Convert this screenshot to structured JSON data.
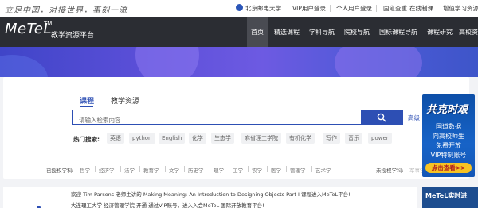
{
  "topbar": {
    "slogan": "立足中国，对接世界，事刻一流",
    "university": "北京邮电大学",
    "links": [
      "VIP用户登录",
      "个人用户登录",
      "国道查重",
      "在线制课",
      "增值学习资源"
    ]
  },
  "navbar": {
    "logo": "MeTeL",
    "logo_tm": "TM",
    "logo_subtitle": "教学资源平台",
    "items": [
      "首页",
      "精选课程",
      "学科导航",
      "院校导航",
      "国标课程导航",
      "课程研究",
      "高校资"
    ]
  },
  "search": {
    "tabs": [
      "课程",
      "教学资源"
    ],
    "placeholder": "请输入检索内容",
    "advanced_label": "高级",
    "hot_label": "热门搜索:",
    "hot_tags": [
      "英语",
      "python",
      "English",
      "化学",
      "生态学",
      "麻省理工学院",
      "有机化学",
      "写作",
      "音乐",
      "power"
    ]
  },
  "subjects": {
    "enabled_label": "已授权学科:",
    "enabled": [
      "哲学",
      "经济学",
      "法学",
      "教育学",
      "文学",
      "历史学",
      "理学",
      "工学",
      "农学",
      "医学",
      "管理学",
      "艺术学"
    ],
    "disabled_label": "未授权学科:",
    "disabled_first": "军事学"
  },
  "promo": {
    "title": "共克时艰",
    "lines": [
      "国道数据",
      "向高校师生",
      "免费开放",
      "VIP特制账号"
    ],
    "button": "点击查看>>"
  },
  "news": {
    "line1": "欢迎 Tim Parsons 老师主讲的 Making Meaning: An Introduction to Designing Objects Part I 课程进入MeTeL平台!",
    "line2": "大连理工大学 经济管理学院 开通 通过VIP账号，进入入会MeTeL 国际开放教育平台!"
  },
  "realtime": {
    "label": "MeTeL实时进"
  },
  "colors": {
    "accent": "#2d4fb4",
    "nav_bg": "#2b2d33",
    "promo_button": "#f7c323"
  }
}
